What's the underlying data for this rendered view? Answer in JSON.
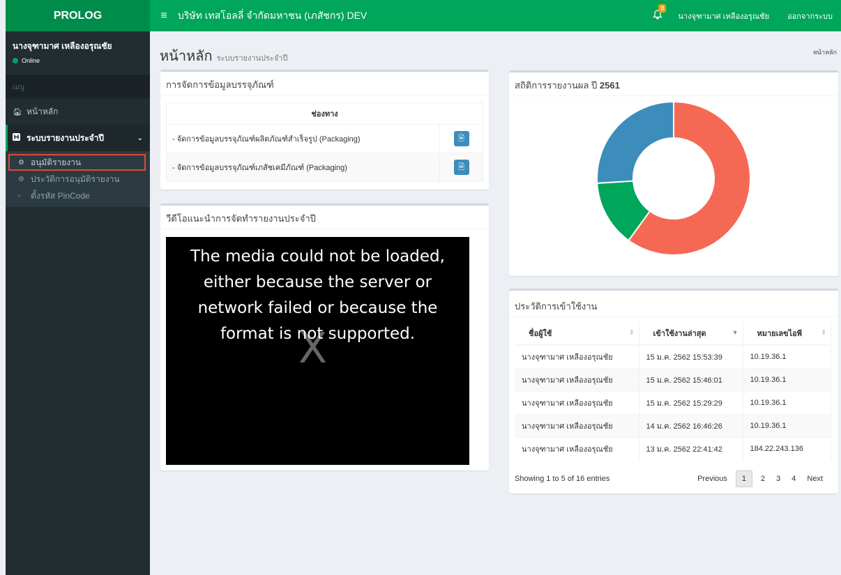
{
  "header": {
    "logo": "PROLOG",
    "menu_icon": "≡",
    "company": "บริษัท เทสโอลลี่ จำกัดมหาชน (เภสัชกร) DEV",
    "notification_count": "0",
    "user": "นางจุฑามาศ เหลืองอรุณชัย",
    "logout": "ออกจากระบบ"
  },
  "sidebar": {
    "user_name": "นางจุฑามาศ เหลืองอรุณชัย",
    "status": "Online",
    "menu_header": "เมนู",
    "items": [
      {
        "label": "หน้าหลัก",
        "icon": "home-icon"
      },
      {
        "label": "ระบบรายงานประจำปี",
        "icon": "h-square-icon"
      }
    ],
    "subitems": [
      {
        "label": "อนุมัติรายงาน",
        "icon": "gear-icon"
      },
      {
        "label": "ประวัติการอนุมัติรายงาน",
        "icon": "gear-icon"
      },
      {
        "label": "ตั้งรหัส PinCode",
        "icon": "square-icon"
      }
    ]
  },
  "page": {
    "title": "หน้าหลัก",
    "subtitle": "ระบบรายงานประจำปี",
    "breadcrumb": "หน้าหลัก"
  },
  "packaging_box": {
    "title": "การจัดการข้อมูลบรรจุภัณฑ์",
    "column": "ช่องทาง",
    "rows": [
      "- จัดการข้อมูลบรรจุภัณฑ์ผลิตภัณฑ์สำเร็จรูป (Packaging)",
      "- จัดการข้อมูลบรรจุภัณฑ์เภสัชเคมีภัณฑ์ (Packaging)"
    ]
  },
  "video_box": {
    "title": "วีดีโอแนะนำการจัดทำรายงานประจำปี",
    "error": "The media could not be loaded, either because the server or network failed or because the format is not supported.",
    "x": "X"
  },
  "stats_box": {
    "title_prefix": "สถิติการรายงานผล ปี ",
    "year": "2561"
  },
  "chart_data": {
    "type": "pie",
    "title": "",
    "values": [
      60,
      14,
      26
    ],
    "colors": [
      "#f56954",
      "#00a65a",
      "#3c8dbc"
    ]
  },
  "history_box": {
    "title": "ประวัติการเข้าใช้งาน",
    "columns": [
      "ชื่อผู้ใช้",
      "เข้าใช้งานล่าสุด",
      "หมายเลขไอพี"
    ],
    "rows": [
      [
        "นางจุฑามาศ เหลืองอรุณชัย",
        "15 ม.ค. 2562 15:53:39",
        "10.19.36.1"
      ],
      [
        "นางจุฑามาศ เหลืองอรุณชัย",
        "15 ม.ค. 2562 15:46:01",
        "10.19.36.1"
      ],
      [
        "นางจุฑามาศ เหลืองอรุณชัย",
        "15 ม.ค. 2562 15:29:29",
        "10.19.36.1"
      ],
      [
        "นางจุฑามาศ เหลืองอรุณชัย",
        "14 ม.ค. 2562 16:46:26",
        "10.19.36.1"
      ],
      [
        "นางจุฑามาศ เหลืองอรุณชัย",
        "13 ม.ค. 2562 22:41:42",
        "184.22.243.136"
      ]
    ],
    "showing": "Showing 1 to 5 of 16 entries",
    "pager": [
      "Previous",
      "1",
      "2",
      "3",
      "4",
      "Next"
    ]
  }
}
